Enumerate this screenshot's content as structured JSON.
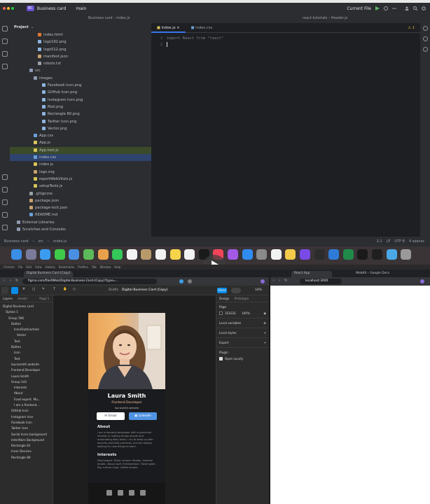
{
  "ide": {
    "project_badge": "BC",
    "project_name": "Business card",
    "branch": "main",
    "run_config": "Current File",
    "path_center": "Business card – index.js",
    "path_right": "react-tutorials – Header.js",
    "project_label": "Project",
    "tree": [
      {
        "label": "index.html",
        "indent": 6,
        "color": "#e37933"
      },
      {
        "label": "logo192.png",
        "indent": 6,
        "color": "#8fb3e0"
      },
      {
        "label": "logo512.png",
        "indent": 6,
        "color": "#8fb3e0"
      },
      {
        "label": "manifest.json",
        "indent": 6,
        "color": "#c9a26d"
      },
      {
        "label": "robots.txt",
        "indent": 6,
        "color": "#9aa0a6"
      },
      {
        "label": "src",
        "indent": 4,
        "color": "#8f9bb3"
      },
      {
        "label": "images",
        "indent": 5,
        "color": "#8f9bb3"
      },
      {
        "label": "Facebook Icon.png",
        "indent": 7,
        "color": "#8fb3e0"
      },
      {
        "label": "GitHub Icon.png",
        "indent": 7,
        "color": "#8fb3e0"
      },
      {
        "label": "Instagram Icon.png",
        "indent": 7,
        "color": "#8fb3e0"
      },
      {
        "label": "Mail.png",
        "indent": 7,
        "color": "#8fb3e0"
      },
      {
        "label": "Rectangle 80.png",
        "indent": 7,
        "color": "#8fb3e0"
      },
      {
        "label": "Twitter Icon.png",
        "indent": 7,
        "color": "#8fb3e0"
      },
      {
        "label": "Vector.png",
        "indent": 7,
        "color": "#8fb3e0"
      },
      {
        "label": "App.css",
        "indent": 5,
        "color": "#6a9fd8"
      },
      {
        "label": "App.js",
        "indent": 5,
        "color": "#d7c45a"
      },
      {
        "label": "App.test.js",
        "indent": 5,
        "color": "#d7c45a"
      },
      {
        "label": "index.css",
        "indent": 5,
        "color": "#6a9fd8"
      },
      {
        "label": "index.js",
        "indent": 5,
        "color": "#d7c45a"
      },
      {
        "label": "logo.svg",
        "indent": 5,
        "color": "#c9a26d"
      },
      {
        "label": "reportWebVitals.js",
        "indent": 5,
        "color": "#d7c45a"
      },
      {
        "label": "setupTests.js",
        "indent": 5,
        "color": "#d7c45a"
      },
      {
        "label": ".gitignore",
        "indent": 4,
        "color": "#9aa0a6"
      },
      {
        "label": "package.json",
        "indent": 4,
        "color": "#c9a26d"
      },
      {
        "label": "package-lock.json",
        "indent": 4,
        "color": "#c9a26d"
      },
      {
        "label": "README.md",
        "indent": 4,
        "color": "#6a9fd8"
      },
      {
        "label": "External Libraries",
        "indent": 1,
        "color": "#8f9bb3"
      },
      {
        "label": "Scratches and Consoles",
        "indent": 1,
        "color": "#8f9bb3"
      }
    ],
    "editor_tabs": [
      "index.js",
      "index.css"
    ],
    "code_lines": [
      "import React from \"react\"",
      ""
    ],
    "warnings": "⚠ 1",
    "status_path": [
      "Business card",
      "src",
      "index.js"
    ],
    "status_right": [
      "2:1",
      "LF",
      "UTF-8",
      "4 spaces"
    ]
  },
  "dock": {
    "icons": [
      {
        "name": "finder",
        "color": "#3a8ee6"
      },
      {
        "name": "launchpad",
        "color": "#7a7a9a"
      },
      {
        "name": "safari",
        "color": "#3b9bef"
      },
      {
        "name": "messages",
        "color": "#3ec94a"
      },
      {
        "name": "mail",
        "color": "#4a90e2"
      },
      {
        "name": "maps",
        "color": "#5dba5a"
      },
      {
        "name": "photos",
        "color": "#e8a04a"
      },
      {
        "name": "facetime",
        "color": "#34c759"
      },
      {
        "name": "calendar",
        "color": "#f2f2f2"
      },
      {
        "name": "contacts",
        "color": "#b89a6a"
      },
      {
        "name": "reminders",
        "color": "#f2f2f2"
      },
      {
        "name": "notes",
        "color": "#f6d44a"
      },
      {
        "name": "freeform",
        "color": "#f2f2f2"
      },
      {
        "name": "appletv",
        "color": "#1a1a1a"
      },
      {
        "name": "music",
        "color": "#f2455a"
      },
      {
        "name": "podcasts",
        "color": "#a259e6"
      },
      {
        "name": "appstore",
        "color": "#2f8cf2"
      },
      {
        "name": "settings",
        "color": "#8a8a8a"
      },
      {
        "name": "preview",
        "color": "#f2f2f2"
      },
      {
        "name": "chrome",
        "color": "#f2c94a"
      },
      {
        "name": "github",
        "color": "#7a4ae6"
      },
      {
        "name": "figma",
        "color": "#2c2c2c"
      },
      {
        "name": "vscode",
        "color": "#2f7bd8"
      },
      {
        "name": "excel",
        "color": "#1f8a4a"
      },
      {
        "name": "terminal",
        "color": "#1a1a1a"
      },
      {
        "name": "webstorm",
        "color": "#1f1f1f"
      },
      {
        "name": "downloads",
        "color": "#4aa8e6"
      },
      {
        "name": "trash",
        "color": "#9a9a9a"
      }
    ],
    "play_icon": "play-icon"
  },
  "browser": {
    "menu": [
      "Chrome",
      "File",
      "Edit",
      "View",
      "History",
      "Bookmarks",
      "Profiles",
      "Tab",
      "Window",
      "Help"
    ],
    "tab_a": "Digital Business Card (Copy)",
    "url_a": "figma.com/file/6Mok/Digital-Business-Card-(Copy)?type=...",
    "tab_b1": "React App",
    "tab_b2": "WebKit – Google Docs",
    "url_b": "localhost:3000"
  },
  "figma": {
    "drafts": "Drafts",
    "file_name": "Digital Business Card (Copy)",
    "share_label": "Share",
    "zoom": "18%",
    "panel_tabs": [
      "Layers",
      "Assets"
    ],
    "page": "Page 1",
    "layers": [
      "Digital Business card",
      "Option 1",
      "Group 566",
      "Button",
      "Icon/Outline/mail",
      "Vector",
      "Text",
      "Button",
      "Icon",
      "Text",
      "laurasmith.website",
      "Frontend Developer",
      "Laura Smith",
      "Group 143",
      "Interests",
      "About",
      "Food expert. Mu...",
      "I am a frontend...",
      "GitHub Icon",
      "Instagram Icon",
      "Facebook Icon",
      "Twitter Icon",
      "Social Icons background",
      "Inter/Kern Background",
      "Rectangle 81",
      "Inner Devices",
      "Rectangle 80"
    ],
    "right_tabs": [
      "Design",
      "Prototype"
    ],
    "page_label": "Page",
    "bg_hex": "1E1E1E",
    "bg_opacity": "100%",
    "local_variables": "Local variables",
    "local_styles": "Local styles",
    "export": "Export",
    "plugin_label": "Plugin",
    "plugin_name": "Open Locofy"
  },
  "card": {
    "name": "Laura Smith",
    "role": "Frontend Developer",
    "site": "laurasmith.website",
    "email_btn": "Email",
    "linkedin_btn": "LinkedIn",
    "about_title": "About",
    "about_text": "I am a frontend developer with a particular interest in making things simple and automating daily tasks. I try to keep up with security and best practices, and am always looking for new things to learn.",
    "interests_title": "Interests",
    "interests_text": "Food expert. Music scholar. Reader. Internet fanatic. Bacon buff. Entrepreneur. Travel geek. Pop culture ninja. Coffee fanatic."
  }
}
